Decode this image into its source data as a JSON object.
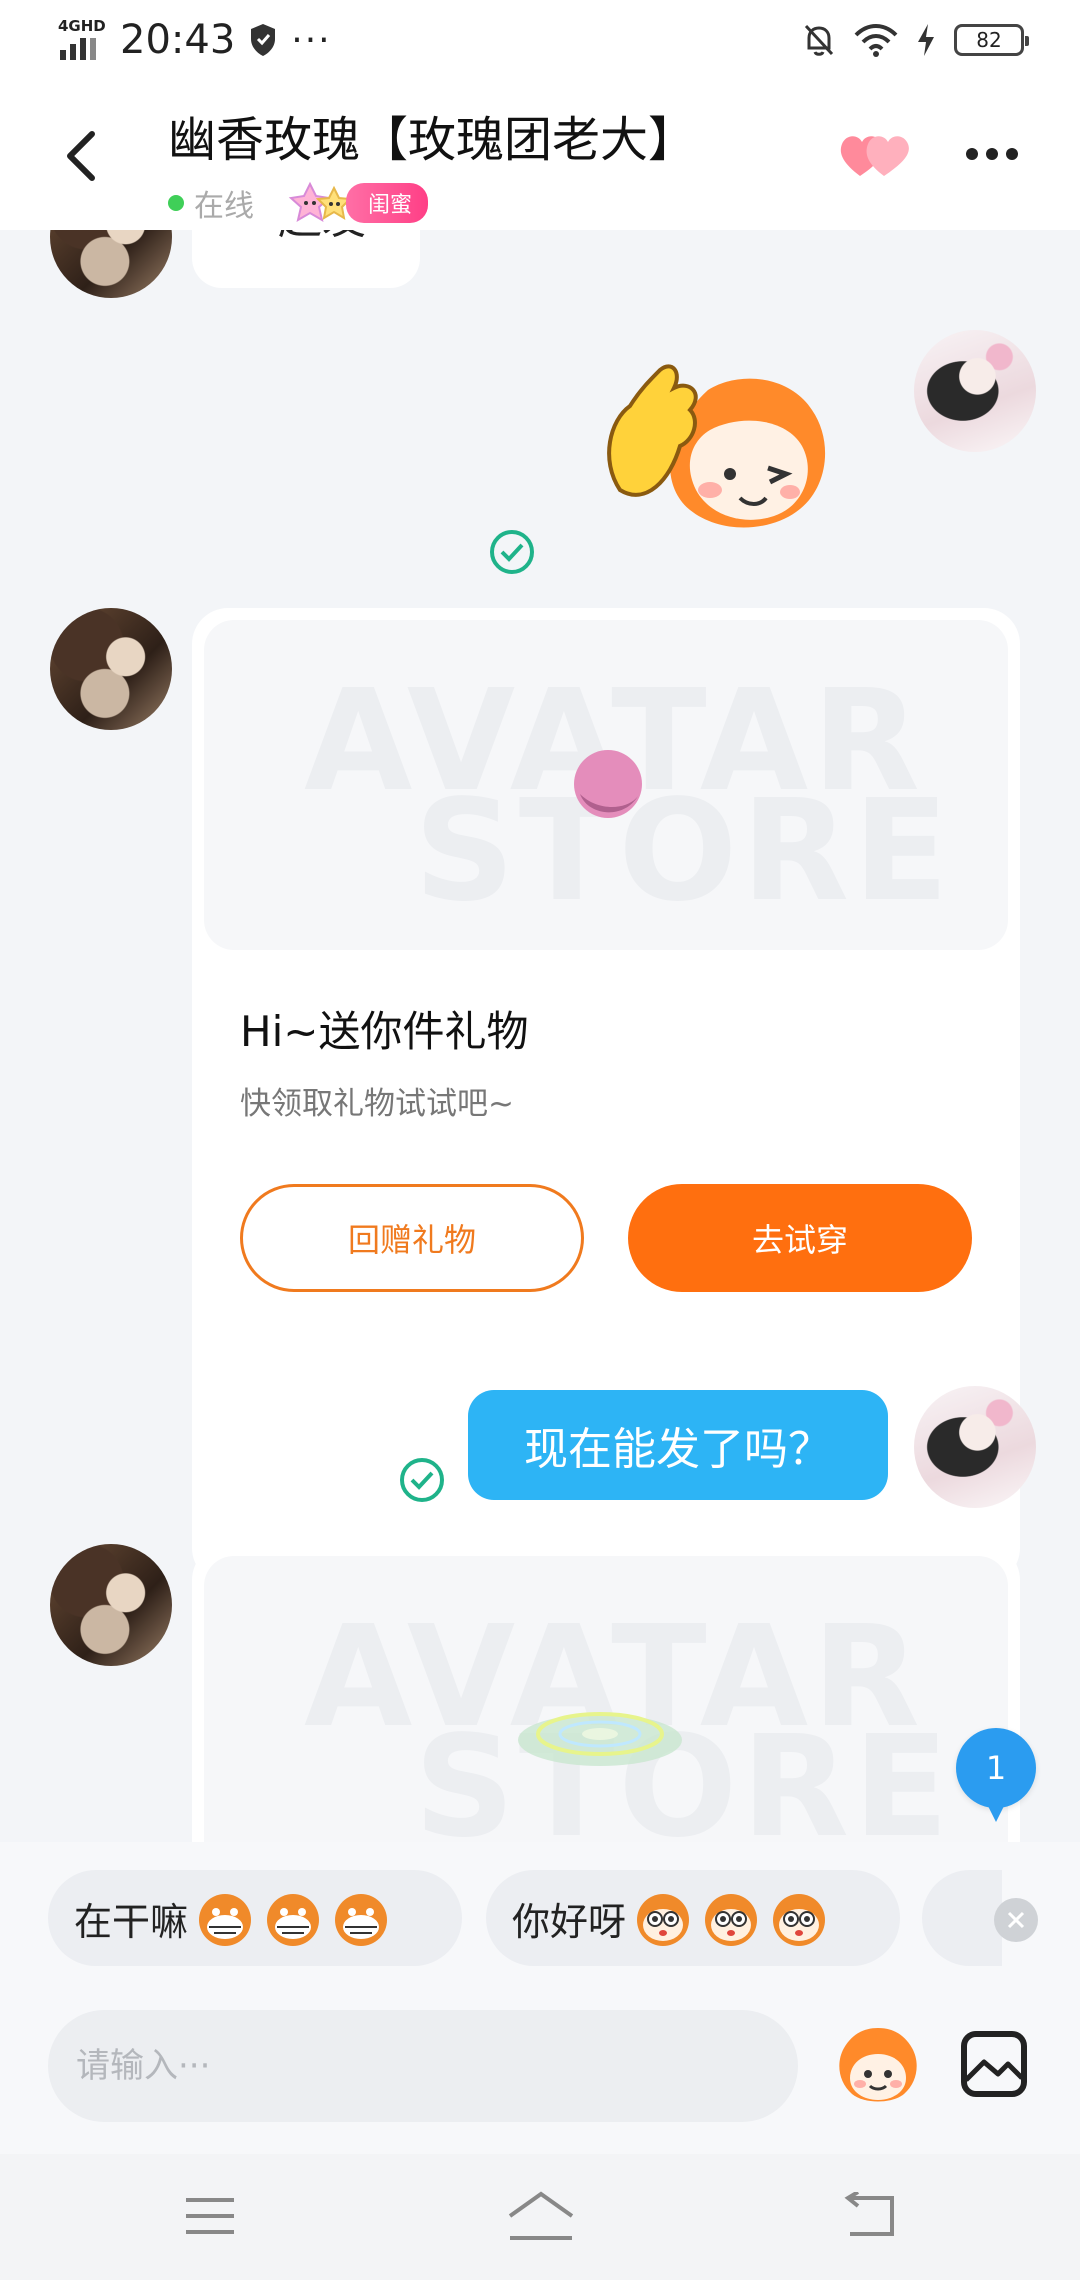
{
  "status_bar": {
    "network": "4GHD",
    "time": "20:43",
    "dots": "···",
    "battery": "82"
  },
  "header": {
    "title": "幽香玫瑰【玫瑰团老大】",
    "status": "在线",
    "relation_badge": "闺蜜"
  },
  "messages": {
    "partial_text": "一起发",
    "gift_card_1": {
      "watermark_line1": "AVATAR",
      "watermark_line2": "STORE",
      "title": "Hi~送你件礼物",
      "subtitle": "快领取礼物试试吧~",
      "return_button": "回赠礼物",
      "try_button": "去试穿"
    },
    "sent_text": "现在能发了吗？",
    "gift_card_2": {
      "watermark_line1": "AVATAR",
      "watermark_line2": "STORE"
    }
  },
  "unread_count": "1",
  "quick_replies": [
    {
      "text": "在干嘛"
    },
    {
      "text": "你好呀"
    }
  ],
  "input": {
    "placeholder": "请输入···"
  },
  "colors": {
    "accent_orange": "#ff6f0f",
    "bubble_blue": "#2db4f5",
    "online_green": "#3fcf58",
    "badge_pink": "#ff4f8f"
  },
  "icons": [
    "back-icon",
    "hearts-icon",
    "more-icon",
    "check-icon",
    "emoji-icon",
    "image-icon",
    "menu-icon",
    "home-icon",
    "back-nav-icon",
    "close-icon"
  ]
}
